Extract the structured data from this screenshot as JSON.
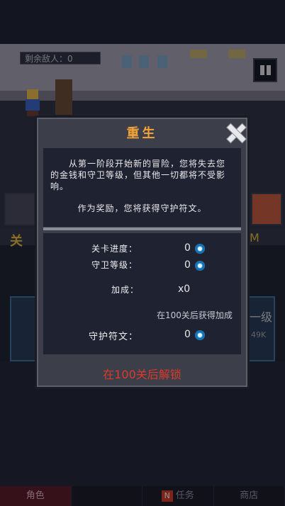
{
  "hud": {
    "enemies_remaining": "剩余敌人：0"
  },
  "background": {
    "level_prefix": "关",
    "level_suffix": "M",
    "panel_text": "一级",
    "panel_sub": "49K"
  },
  "bottom_nav": {
    "tabs": [
      {
        "label": "角色",
        "active": true
      },
      {
        "label": "",
        "active": false
      },
      {
        "label": "任务",
        "badge": "N",
        "active": false
      },
      {
        "label": "商店",
        "active": false
      }
    ]
  },
  "dialog": {
    "title": "重生",
    "description": "从第一阶段开始新的冒险，您将失去您的金钱和守卫等级，但其他一切都将不受影响。",
    "reward_line": "作为奖励，您将获得守护符文。",
    "stats": {
      "stage_progress_label": "关卡进度：",
      "stage_progress_value": "0",
      "guard_level_label": "守卫等级：",
      "guard_level_value": "0",
      "bonus_label": "加成：",
      "bonus_value": "x0",
      "bonus_note": "在100关后获得加成",
      "rune_label": "守护符文：",
      "rune_value": "0"
    },
    "unlock_text": "在100关后解锁"
  },
  "colors": {
    "title": "#f2a33a",
    "unlock": "#d93a2a",
    "rune": "#34a3e0",
    "dialog_bg": "#3c3f4a",
    "panel_bg": "#1f2230"
  }
}
